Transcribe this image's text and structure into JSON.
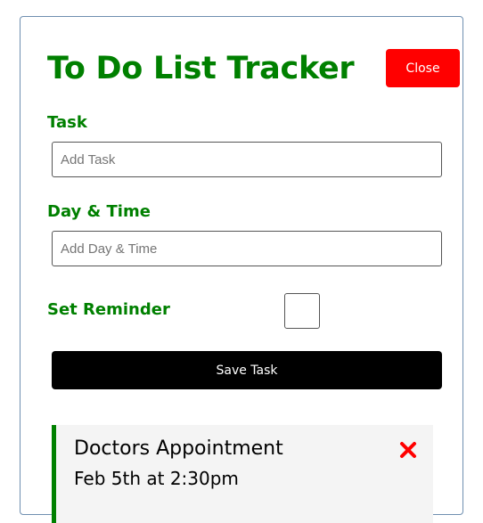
{
  "header": {
    "title": "To Do List Tracker",
    "close_label": "Close"
  },
  "form": {
    "task_label": "Task",
    "task_placeholder": "Add Task",
    "task_value": "",
    "day_label": "Day & Time",
    "day_placeholder": "Add Day & Time",
    "day_value": "",
    "reminder_label": "Set Reminder",
    "reminder_checked": false,
    "save_label": "Save Task"
  },
  "tasks": [
    {
      "text": "Doctors Appointment",
      "day": "Feb 5th at 2:30pm",
      "reminder": true,
      "delete_icon": "close-x-icon"
    }
  ],
  "colors": {
    "accent": "#008000",
    "danger": "#ff0000",
    "primary_button": "#000000",
    "task_bg": "#f4f4f4",
    "border": "#6f8fb0"
  }
}
